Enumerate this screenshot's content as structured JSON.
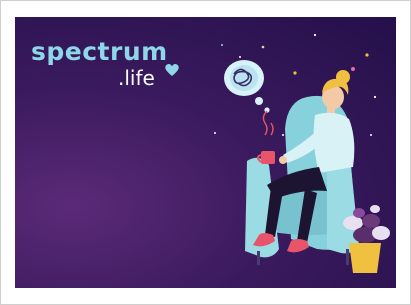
{
  "brand": {
    "name": "spectrum",
    "suffix": ".life",
    "colors": {
      "primary": "#8fd6e8",
      "suffix": "#ffffff",
      "heart": "#8fd6e8"
    }
  },
  "scene": {
    "background": "#2c1452",
    "icons": [
      "heart-icon",
      "thought-bubble-icon",
      "scribble-icon",
      "coffee-mug-icon",
      "potted-plant-icon"
    ]
  }
}
